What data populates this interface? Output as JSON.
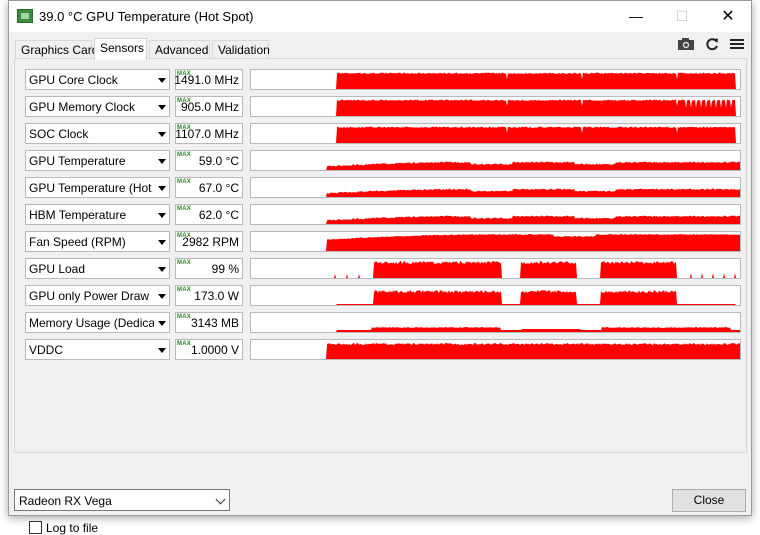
{
  "window": {
    "title": "39.0 °C GPU Temperature (Hot Spot)",
    "controls": {
      "minimize": "—",
      "maximize": "☐",
      "close": "✕"
    }
  },
  "tabs": [
    {
      "label": "Graphics Card",
      "active": false
    },
    {
      "label": "Sensors",
      "active": true
    },
    {
      "label": "Advanced",
      "active": false
    },
    {
      "label": "Validation",
      "active": false
    }
  ],
  "toolbar": {
    "icons": [
      "camera-icon",
      "refresh-icon",
      "menu-icon"
    ]
  },
  "max_tag": "MAX",
  "graph_color": "#ff0000",
  "sensors": [
    {
      "name": "GPU Core Clock",
      "value": "1491.0 MHz",
      "trace": "clock"
    },
    {
      "name": "GPU Memory Clock",
      "value": "905.0 MHz",
      "trace": "memclock"
    },
    {
      "name": "SOC Clock",
      "value": "1107.0 MHz",
      "trace": "soc"
    },
    {
      "name": "GPU Temperature",
      "value": "59.0 °C",
      "trace": "temp"
    },
    {
      "name": "GPU Temperature (Hot Spot)",
      "value": "67.0 °C",
      "trace": "hotspot"
    },
    {
      "name": "HBM Temperature",
      "value": "62.0 °C",
      "trace": "temp"
    },
    {
      "name": "Fan Speed (RPM)",
      "value": "2982 RPM",
      "trace": "fan"
    },
    {
      "name": "GPU Load",
      "value": "99 %",
      "trace": "load"
    },
    {
      "name": "GPU only Power Draw",
      "value": "173.0 W",
      "trace": "power"
    },
    {
      "name": "Memory Usage (Dedicated)",
      "value": "3143 MB",
      "trace": "memusage"
    },
    {
      "name": "VDDC",
      "value": "1.0000 V",
      "trace": "vddc"
    }
  ],
  "footer": {
    "log_to_file": "Log to file",
    "log_checked": false,
    "gpu_selected": "Radeon RX Vega",
    "close_label": "Close"
  }
}
